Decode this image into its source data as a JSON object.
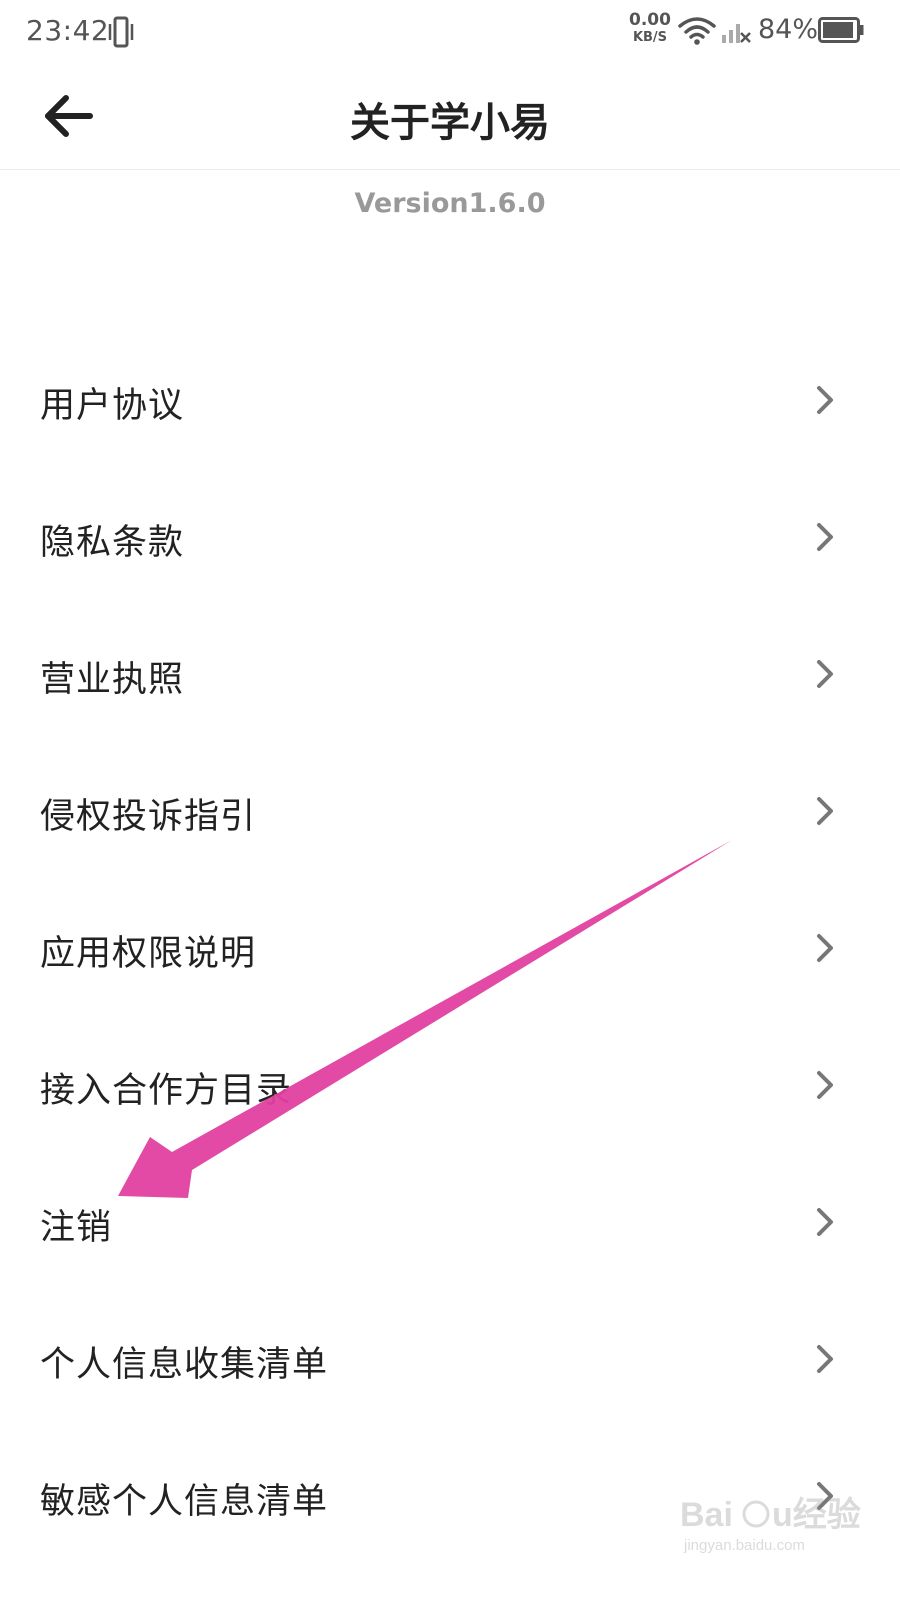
{
  "status_bar": {
    "time": "23:42",
    "net_speed_value": "0.00",
    "net_speed_unit": "KB/S",
    "battery_percent": "84%",
    "icons": [
      "vibrate-icon",
      "wifi-icon",
      "signal-icon",
      "battery-icon"
    ]
  },
  "nav": {
    "title": "关于学小易",
    "back_icon": "back-arrow-icon"
  },
  "version": "Version1.6.0",
  "menu": {
    "items": [
      {
        "label": "用户协议"
      },
      {
        "label": "隐私条款"
      },
      {
        "label": "营业执照"
      },
      {
        "label": "侵权投诉指引"
      },
      {
        "label": "应用权限说明"
      },
      {
        "label": "接入合作方目录"
      },
      {
        "label": "注销"
      },
      {
        "label": "个人信息收集清单"
      },
      {
        "label": "敏感个人信息清单"
      }
    ],
    "chevron_icon": "chevron-right-icon"
  },
  "annotation": {
    "color": "#e040a0",
    "points_to": "注销"
  },
  "watermark": {
    "text": "Baidu经验",
    "subtext": "jingyan.baidu.com"
  }
}
